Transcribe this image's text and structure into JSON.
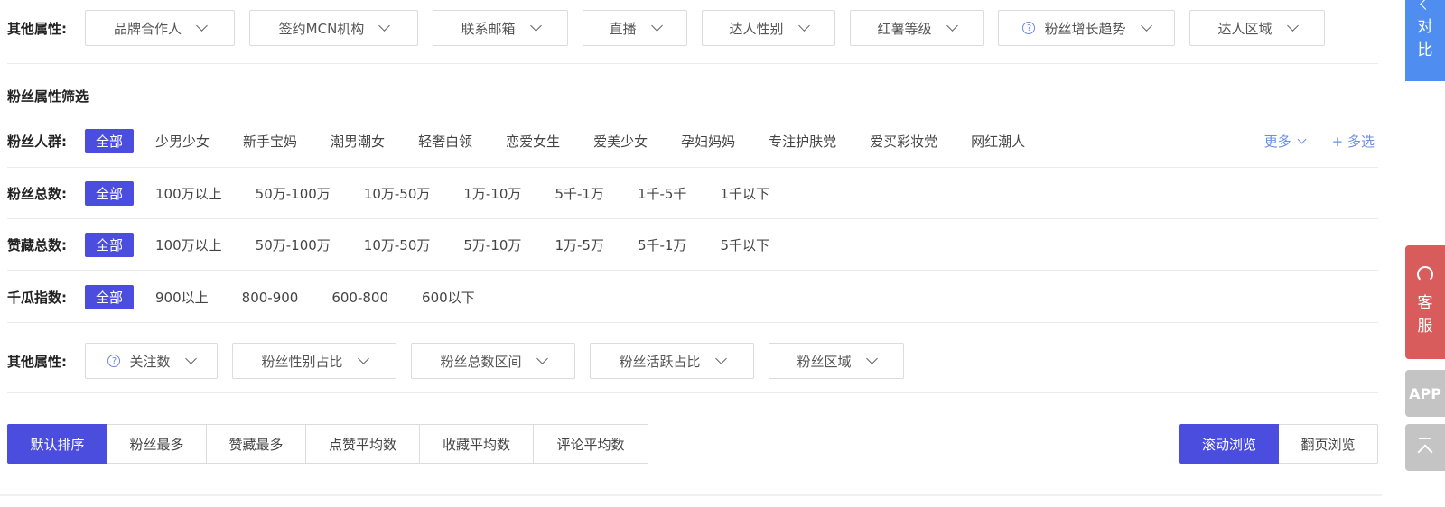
{
  "top_filters": {
    "label": "其他属性:",
    "items": [
      {
        "label": "品牌合作人",
        "help": false
      },
      {
        "label": "签约MCN机构",
        "help": false
      },
      {
        "label": "联系邮箱",
        "help": false
      },
      {
        "label": "直播",
        "help": false
      },
      {
        "label": "达人性别",
        "help": false
      },
      {
        "label": "红薯等级",
        "help": false
      },
      {
        "label": "粉丝增长趋势",
        "help": true
      },
      {
        "label": "达人区域",
        "help": false
      }
    ]
  },
  "fan_section": {
    "title": "粉丝属性筛选",
    "crowd": {
      "label": "粉丝人群:",
      "all": "全部",
      "options": [
        "少男少女",
        "新手宝妈",
        "潮男潮女",
        "轻奢白领",
        "恋爱女生",
        "爱美少女",
        "孕妇妈妈",
        "专注护肤党",
        "爱买彩妆党",
        "网红潮人"
      ],
      "more": "更多",
      "multi": "+ 多选"
    },
    "fans_total": {
      "label": "粉丝总数:",
      "all": "全部",
      "options": [
        "100万以上",
        "50万-100万",
        "10万-50万",
        "1万-10万",
        "5千-1万",
        "1千-5千",
        "1千以下"
      ]
    },
    "likes_total": {
      "label": "赞藏总数:",
      "all": "全部",
      "options": [
        "100万以上",
        "50万-100万",
        "10万-50万",
        "5万-10万",
        "1万-5万",
        "5千-1万",
        "5千以下"
      ]
    },
    "qiangua_index": {
      "label": "千瓜指数:",
      "all": "全部",
      "options": [
        "900以上",
        "800-900",
        "600-800",
        "600以下"
      ]
    },
    "other": {
      "label": "其他属性:",
      "items": [
        {
          "label": "关注数",
          "help": true
        },
        {
          "label": "粉丝性别占比",
          "help": false
        },
        {
          "label": "粉丝总数区间",
          "help": false
        },
        {
          "label": "粉丝活跃占比",
          "help": false
        },
        {
          "label": "粉丝区域",
          "help": false
        }
      ]
    }
  },
  "sort": {
    "items": [
      "默认排序",
      "粉丝最多",
      "赞藏最多",
      "点赞平均数",
      "收藏平均数",
      "评论平均数"
    ],
    "active": "默认排序"
  },
  "view": {
    "scroll": "滚动浏览",
    "page": "翻页浏览",
    "active": "滚动浏览"
  },
  "float_bar": {
    "compare": [
      "对",
      "比"
    ],
    "service": [
      "客",
      "服"
    ],
    "app": "APP"
  },
  "colors": {
    "accent": "#4b4ddf",
    "link": "#6b8fe0",
    "compare_bg": "#4f8ef0",
    "service_bg": "#d95c5c",
    "gray_bg": "#c4c4c4"
  }
}
